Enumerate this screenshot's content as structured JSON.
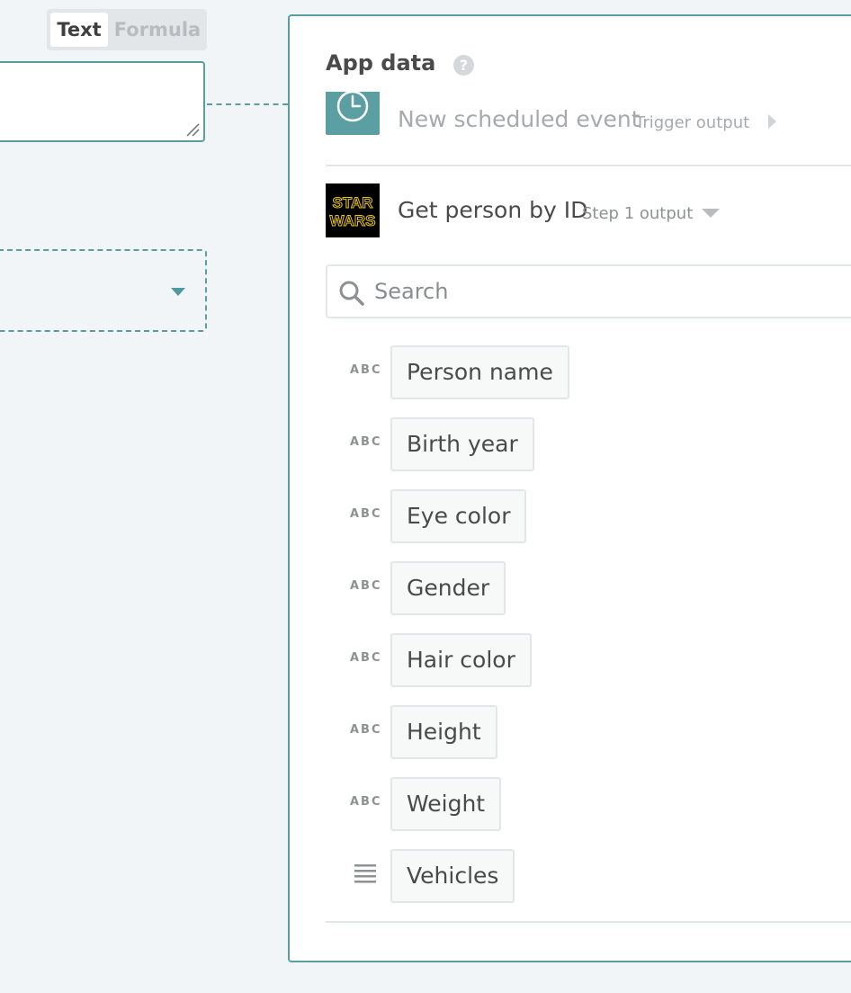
{
  "mode_toggle": {
    "text_label": "Text",
    "formula_label": "Formula",
    "selected": "Text"
  },
  "panel": {
    "title": "App data",
    "help_symbol": "?",
    "trigger": {
      "name": "New scheduled event",
      "sub": "Trigger output",
      "icon": "clock-icon"
    },
    "step1": {
      "name": "Get person by ID",
      "sub": "Step 1 output",
      "icon": "star-wars-logo",
      "logo_text_1": "STAR",
      "logo_text_2": "WARS"
    },
    "search": {
      "placeholder": "Search"
    },
    "fields": [
      {
        "type": "ABC",
        "label": "Person name"
      },
      {
        "type": "ABC",
        "label": "Birth year"
      },
      {
        "type": "ABC",
        "label": "Eye color"
      },
      {
        "type": "ABC",
        "label": "Gender"
      },
      {
        "type": "ABC",
        "label": "Hair color"
      },
      {
        "type": "ABC",
        "label": "Height"
      },
      {
        "type": "ABC",
        "label": "Weight"
      },
      {
        "type": "list",
        "label": "Vehicles"
      }
    ]
  },
  "colors": {
    "accent": "#5b9ea1",
    "background": "#f1f5f8",
    "logo_yellow": "#e8c31c"
  }
}
